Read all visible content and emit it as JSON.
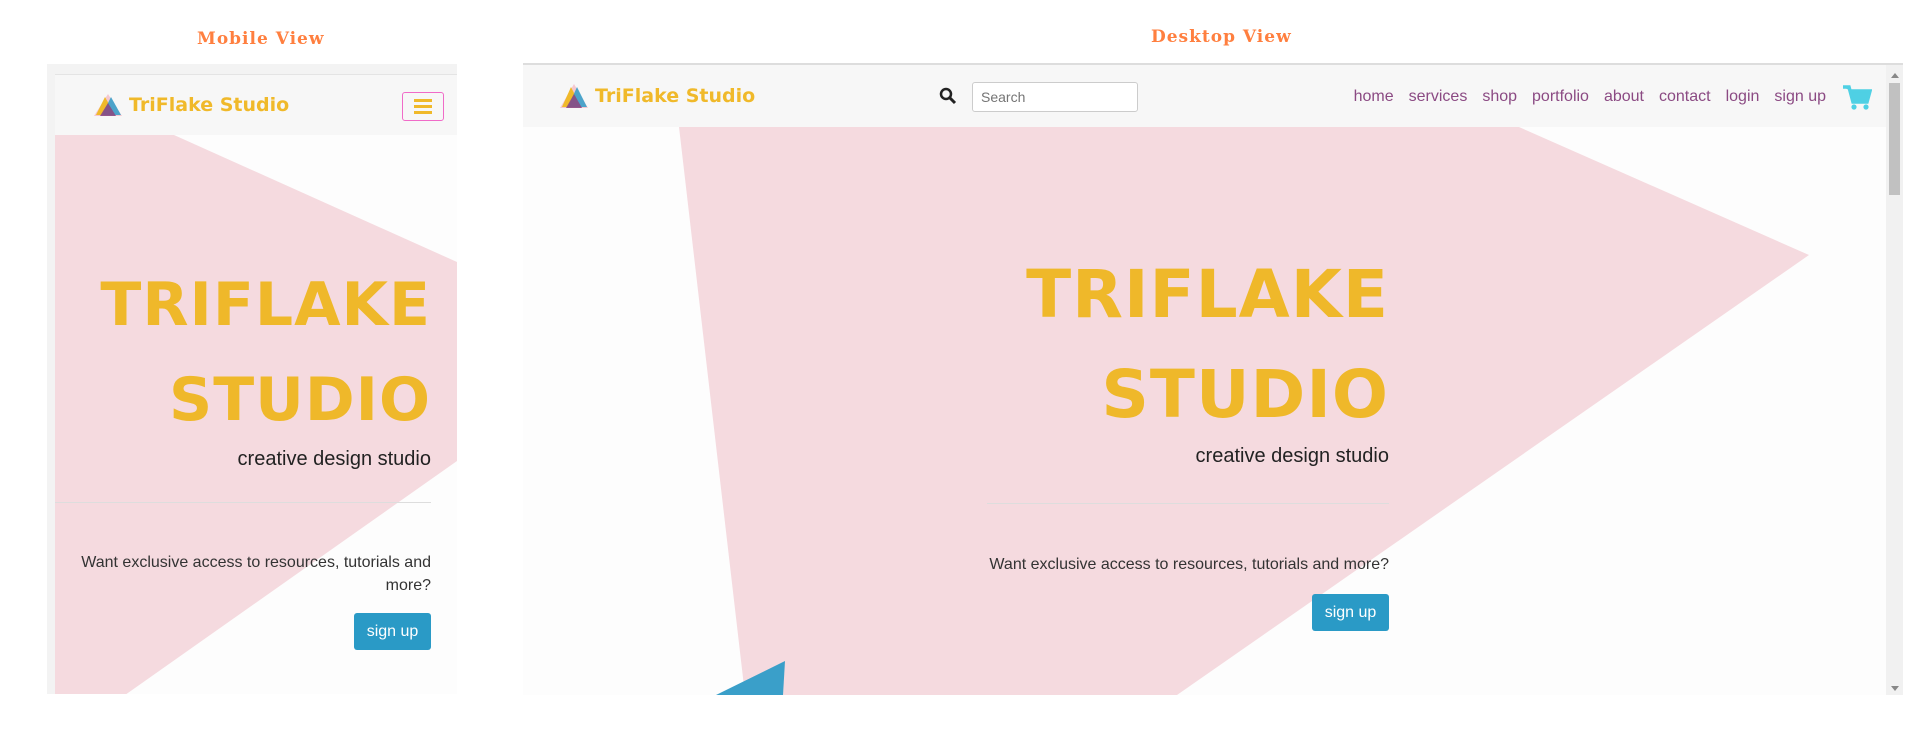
{
  "labels": {
    "mobile": "Mobile View",
    "desktop": "Desktop View"
  },
  "brand": "TriFlake Studio",
  "hero": {
    "line1": "TRIFLAKE",
    "line2": "STUDIO",
    "subtitle": "creative design studio",
    "message": "Want exclusive access to resources, tutorials and more?",
    "button": "sign up"
  },
  "search": {
    "placeholder": "Search"
  },
  "nav": [
    "home",
    "services",
    "shop",
    "portfolio",
    "about",
    "contact",
    "login",
    "sign up"
  ],
  "icons": {
    "search": "search-icon",
    "cart": "cart-icon",
    "menu": "hamburger-icon",
    "logo": "triangle-logo-icon"
  },
  "colors": {
    "brand": "#efb82a",
    "pink": "#f5dadf",
    "blue": "#3a9fc9",
    "link": "#8b4a83",
    "button": "#2a9ac6",
    "label": "#ff7f3f",
    "cart": "#4fd0e4"
  }
}
